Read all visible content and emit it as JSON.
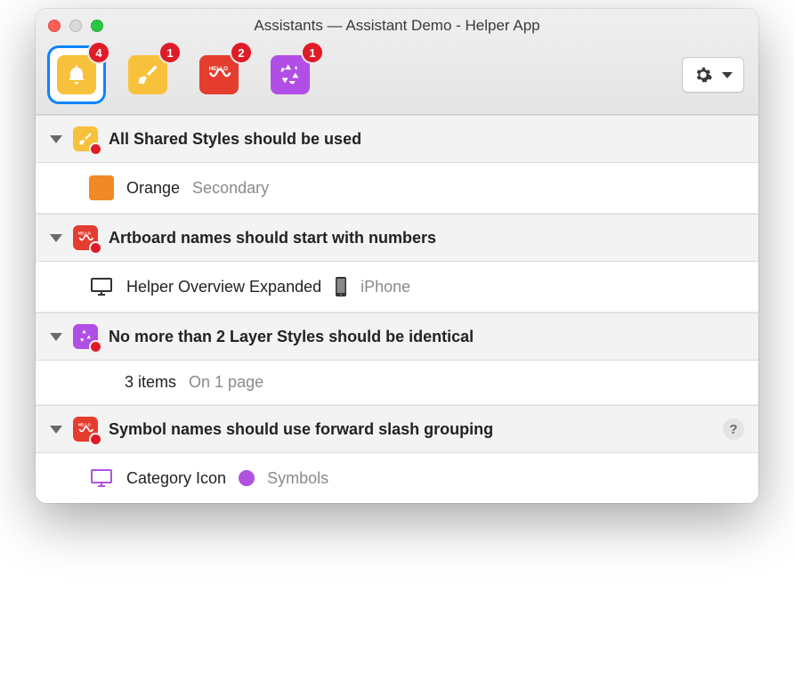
{
  "window": {
    "title": "Assistants — Assistant Demo - Helper App"
  },
  "tabs": [
    {
      "name": "bell",
      "badge": "4",
      "selected": true
    },
    {
      "name": "broom",
      "badge": "1",
      "selected": false
    },
    {
      "name": "hello",
      "badge": "2",
      "selected": false
    },
    {
      "name": "recycle",
      "badge": "1",
      "selected": false
    }
  ],
  "sections": [
    {
      "icon": "broom",
      "title": "All Shared Styles should be used",
      "items": [
        {
          "icon": "swatch-orange",
          "primary": "Orange",
          "secondary": "Secondary"
        }
      ]
    },
    {
      "icon": "hello",
      "title": "Artboard names should start with numbers",
      "items": [
        {
          "icon": "artboard",
          "primary": "Helper Overview Expanded",
          "deviceIcon": "iphone",
          "secondary": "iPhone"
        }
      ]
    },
    {
      "icon": "recycle",
      "title": "No more than 2 Layer Styles should be identical",
      "items": [
        {
          "primary": "3 items",
          "secondary": "On 1 page"
        }
      ]
    },
    {
      "icon": "hello",
      "title": "Symbol names should use forward slash grouping",
      "help": true,
      "items": [
        {
          "icon": "symbol-artboard",
          "primary": "Category Icon",
          "pageDot": "purple",
          "secondary": "Symbols"
        }
      ]
    }
  ]
}
